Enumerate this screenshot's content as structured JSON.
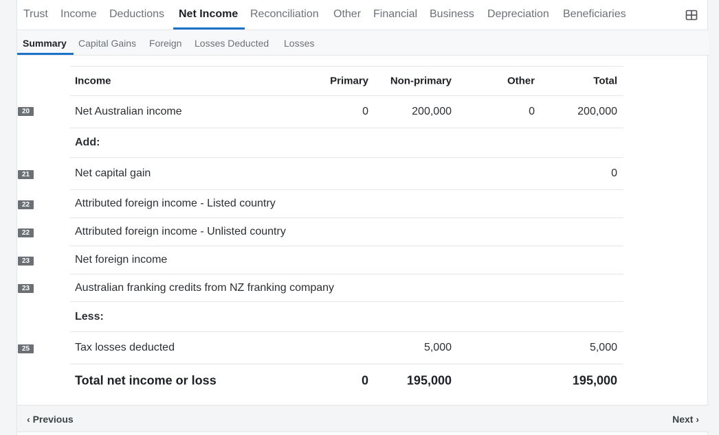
{
  "top_tabs": [
    "Trust",
    "Income",
    "Deductions",
    "Net Income",
    "Reconciliation",
    "Other",
    "Financial",
    "Business",
    "Depreciation",
    "Beneficiaries"
  ],
  "top_tabs_active": "Net Income",
  "sub_tabs": [
    "Summary",
    "Capital Gains",
    "Foreign",
    "Losses Deducted",
    "Losses"
  ],
  "sub_tabs_active": "Summary",
  "table": {
    "headers": {
      "label": "Income",
      "primary": "Primary",
      "non_primary": "Non-primary",
      "other": "Other",
      "total": "Total"
    },
    "rows": [
      {
        "badge": "20",
        "label": "Net Australian income",
        "primary": "0",
        "non_primary": "200,000",
        "other": "0",
        "total": "200,000"
      },
      {
        "badge": "",
        "label": "Add:",
        "primary": "",
        "non_primary": "",
        "other": "",
        "total": ""
      },
      {
        "badge": "21",
        "label": "Net capital gain",
        "primary": "",
        "non_primary": "",
        "other": "",
        "total": "0"
      },
      {
        "badge": "22",
        "label": "Attributed foreign income - Listed country",
        "primary": "",
        "non_primary": "",
        "other": "",
        "total": ""
      },
      {
        "badge": "22",
        "label": "Attributed foreign income - Unlisted country",
        "primary": "",
        "non_primary": "",
        "other": "",
        "total": ""
      },
      {
        "badge": "23",
        "label": "Net foreign income",
        "primary": "",
        "non_primary": "",
        "other": "",
        "total": ""
      },
      {
        "badge": "23",
        "label": "Australian franking credits from NZ franking company",
        "primary": "",
        "non_primary": "",
        "other": "",
        "total": ""
      },
      {
        "badge": "",
        "label": "Less:",
        "primary": "",
        "non_primary": "",
        "other": "",
        "total": ""
      },
      {
        "badge": "25",
        "label": "Tax losses deducted",
        "primary": "",
        "non_primary": "5,000",
        "other": "",
        "total": "5,000"
      }
    ],
    "total_row": {
      "label": "Total net income or loss",
      "primary": "0",
      "non_primary": "195,000",
      "other": "",
      "total": "195,000"
    }
  },
  "footer": {
    "previous_label": "Previous",
    "next_label": "Next"
  },
  "colors": {
    "accent": "#1a73c9",
    "badge": "#6b7075"
  }
}
